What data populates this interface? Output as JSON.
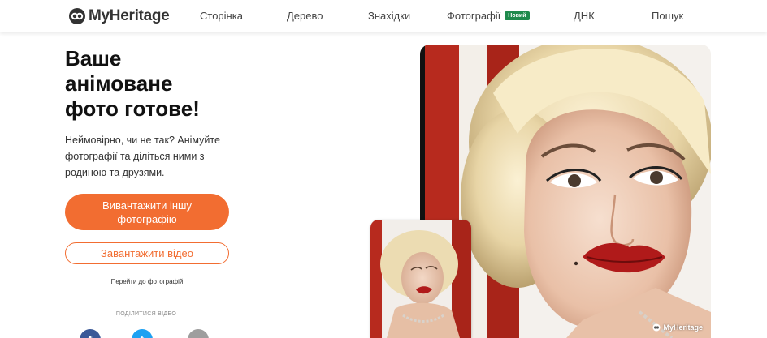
{
  "brand": {
    "logo_text": "MyHeritage",
    "accent": "#f26d31",
    "badge_color": "#1f8a4c"
  },
  "nav": {
    "items": [
      {
        "label": "Сторінка"
      },
      {
        "label": "Дерево"
      },
      {
        "label": "Знахідки"
      },
      {
        "label": "Фотографії",
        "badge": "Новий"
      },
      {
        "label": "ДНК"
      },
      {
        "label": "Пошук"
      }
    ]
  },
  "hero": {
    "headline_lines": [
      "Ваше",
      "анімоване",
      "фото готове!"
    ],
    "subtext": "Неймовірно, чи не так? Анімуйте фотографії та діліться ними з родиною та друзями.",
    "upload_button": "Вивантажити іншу фотографію",
    "download_button": "Завантажити відео",
    "photos_link": "Перейти до фотографій",
    "share_label": "ПОДІЛИТИСЯ ВІДЕО"
  },
  "social": [
    {
      "icon": "facebook-icon",
      "color": "#3b5998",
      "glyph": "f"
    },
    {
      "icon": "twitter-icon",
      "color": "#1da1f2",
      "glyph": "t"
    },
    {
      "icon": "link-icon",
      "color": "#9e9e9e",
      "glyph": "∞"
    }
  ],
  "photo": {
    "watermark": "MyHeritage"
  }
}
